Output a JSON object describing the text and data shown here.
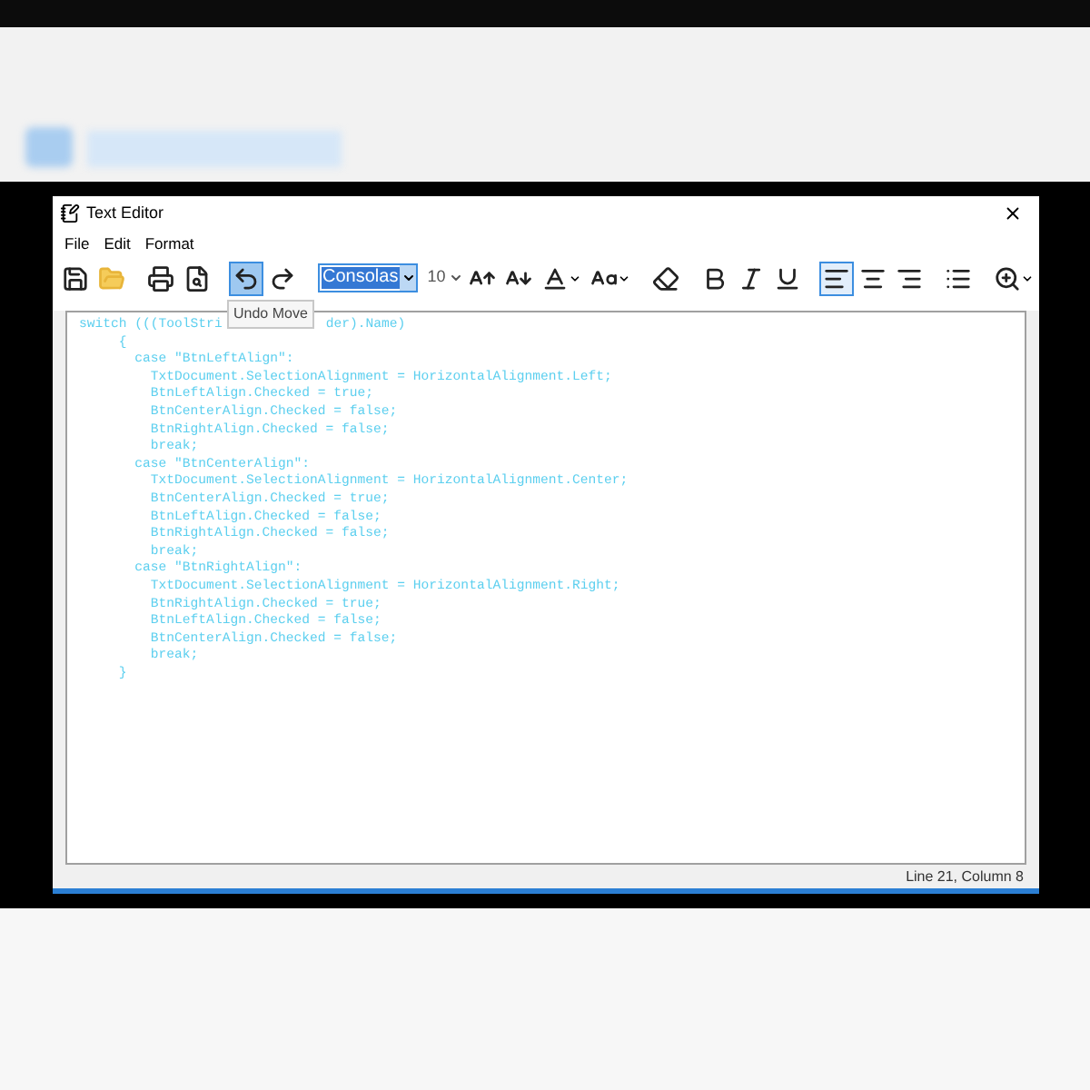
{
  "window": {
    "title": "Text Editor"
  },
  "menu": [
    {
      "label": "File"
    },
    {
      "label": "Edit"
    },
    {
      "label": "Format"
    }
  ],
  "toolbar": [
    {
      "kind": "button"
    },
    {
      "kind": "button"
    },
    {
      "kind": "separator"
    },
    {
      "kind": "button"
    },
    {
      "kind": "button"
    },
    {
      "kind": "separator"
    },
    {
      "kind": "button",
      "hovered": true
    },
    {
      "kind": "button"
    },
    {
      "kind": "separator"
    },
    {
      "kind": "font-box",
      "value": "Consolas",
      "selected": true
    },
    {
      "kind": "size-box",
      "value": "10"
    },
    {
      "kind": "button"
    },
    {
      "kind": "button"
    },
    {
      "kind": "button"
    },
    {
      "kind": "button"
    },
    {
      "kind": "separator"
    },
    {
      "kind": "button"
    },
    {
      "kind": "separator"
    },
    {
      "kind": "button"
    },
    {
      "kind": "button"
    },
    {
      "kind": "button"
    },
    {
      "kind": "separator"
    },
    {
      "kind": "button",
      "selected": true
    },
    {
      "kind": "button",
      "selected": false
    },
    {
      "kind": "button",
      "selected": false
    },
    {
      "kind": "separator"
    },
    {
      "kind": "button"
    },
    {
      "kind": "separator"
    },
    {
      "kind": "button"
    }
  ],
  "tooltip": "Undo Move",
  "editor": {
    "first_line": {
      "before": "switch (((ToolStri",
      "after": "der).Name)"
    },
    "lines": [
      "     {",
      "       case \"BtnLeftAlign\":",
      "         TxtDocument.SelectionAlignment = HorizontalAlignment.Left;",
      "         BtnLeftAlign.Checked = true;",
      "         BtnCenterAlign.Checked = false;",
      "         BtnRightAlign.Checked = false;",
      "         break;",
      "       case \"BtnCenterAlign\":",
      "         TxtDocument.SelectionAlignment = HorizontalAlignment.Center;",
      "         BtnCenterAlign.Checked = true;",
      "         BtnLeftAlign.Checked = false;",
      "         BtnRightAlign.Checked = false;",
      "         break;",
      "       case \"BtnRightAlign\":",
      "         TxtDocument.SelectionAlignment = HorizontalAlignment.Right;",
      "         BtnRightAlign.Checked = true;",
      "         BtnLeftAlign.Checked = false;",
      "         BtnCenterAlign.Checked = false;",
      "         break;",
      "     }"
    ]
  },
  "status_bar": {
    "position": "Line 21, Column 8"
  }
}
